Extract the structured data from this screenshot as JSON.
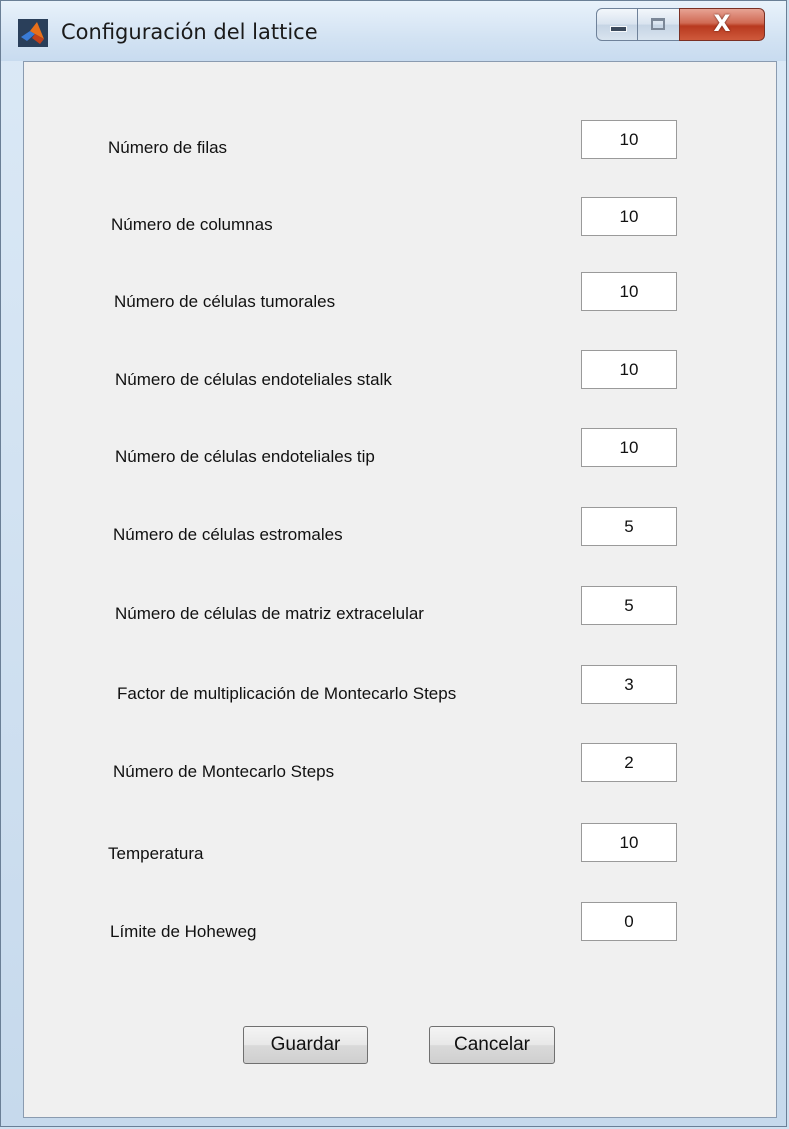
{
  "window": {
    "title": "Configuración del lattice",
    "close_glyph": "X",
    "accent_close": "#c8452a"
  },
  "fields": [
    {
      "label": "Número de filas",
      "value": "10"
    },
    {
      "label": "Número de columnas",
      "value": "10"
    },
    {
      "label": "Número de células tumorales",
      "value": "10"
    },
    {
      "label": "Número de células endoteliales stalk",
      "value": "10"
    },
    {
      "label": "Número de células endoteliales tip",
      "value": "10"
    },
    {
      "label": "Número de células estromales",
      "value": "5"
    },
    {
      "label": "Número de células de matriz extracelular",
      "value": "5"
    },
    {
      "label": "Factor de multiplicación de Montecarlo Steps",
      "value": "3"
    },
    {
      "label": "Número de Montecarlo Steps",
      "value": "2"
    },
    {
      "label": "Temperatura",
      "value": "10"
    },
    {
      "label": "Límite de Hoheweg",
      "value": "0"
    }
  ],
  "buttons": {
    "save_label": "Guardar",
    "cancel_label": "Cancelar"
  },
  "icons": {
    "app": "matlab-icon",
    "minimize": "minimize-icon",
    "maximize": "maximize-icon",
    "close": "close-icon"
  }
}
